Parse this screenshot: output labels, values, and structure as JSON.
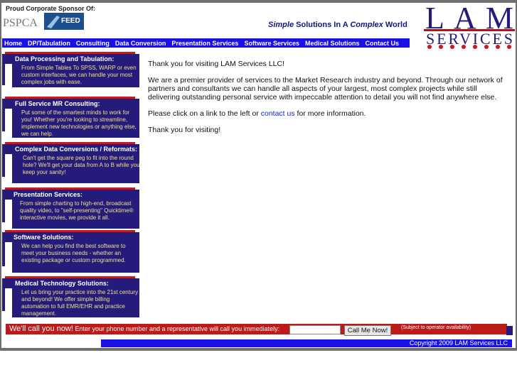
{
  "header": {
    "sponsor_label": "Proud Corporate  Sponsor Of:",
    "tagline_1": "Simple",
    "tagline_2": " Solutions In A ",
    "tagline_3": "Complex",
    "tagline_4": " World",
    "logo_text_1": "LAM",
    "logo_text_2": "SERVICES",
    "sponsor_logo_1": "PSPCA",
    "sponsor_logo_2": "FEED"
  },
  "nav": {
    "items": [
      "Home",
      "DP/Tabulation",
      "Consulting",
      "Data Conversion",
      "Presentation Services",
      "Software Services",
      "Medical Solutions",
      "Contact Us"
    ]
  },
  "cards": [
    {
      "title": "Data Processing and Tabulation:",
      "text": "From Simple Tables To SPSS, WARP or even custom interfaces, we can handle your most complex jobs with ease."
    },
    {
      "title": "Full Service MR Consulting:",
      "text": "Put some of the smartest minds to work for you!  Whether you're looking to streamline, implement new technologies or anything else, we can help."
    },
    {
      "title": "Complex Data Conversions / Reformats:",
      "text": "Can't get the square peg to fit into the round hole?  We'll get your data from A to B while you keep your sanity!"
    },
    {
      "title": "Presentation Services:",
      "text": "From simple charting to high-end, broadcast quality video, to \"self-presenting\" Quicktime® interactive movies, we provide it all."
    },
    {
      "title": "Software Solutions:",
      "text": "We can help you find the best software to meet your business needs - whether an existing package or custom programmed."
    },
    {
      "title": "Medical Technology Solutions:",
      "text": "Let us bring your practice into the 21st century and beyond!  We offer simple billing automation to full EMR/EHR and practice management."
    }
  ],
  "main": {
    "p1": "Thank you for visiting LAM Services LLC!",
    "p2": "We are a premier provider of services to the Market Research industry and beyond.  Through our network of partners and consultants we can handle all aspects of your largest, most complex projects while still delivering outstanding personal service with impeccable attention to detail you will not find anywhere else.",
    "p3_pre": "Please click on a link to the left or ",
    "p3_link": "contact us",
    "p3_post": " for more information.",
    "p4": "Thank you for visiting!"
  },
  "callback": {
    "lead": "We'll call you now!",
    "text": " Enter your phone number and a representative will call you immediately:",
    "phone_value": "",
    "button_label": "Call Me Now!",
    "note": "(Subject to operator availability)"
  },
  "footer": {
    "copyright": "Copyright 2009 LAM Services LLC"
  }
}
